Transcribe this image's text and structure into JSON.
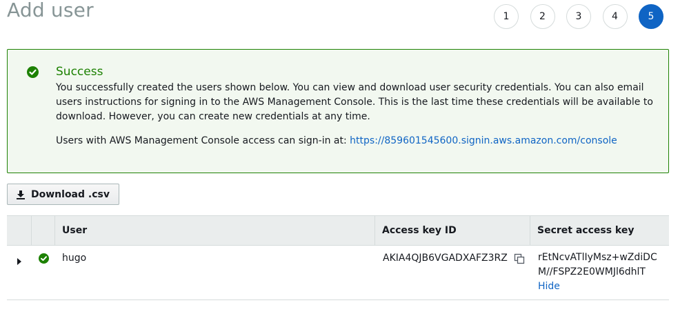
{
  "page": {
    "title": "Add user"
  },
  "steps": [
    "1",
    "2",
    "3",
    "4",
    "5"
  ],
  "active_step": "5",
  "alert": {
    "title": "Success",
    "body": "You successfully created the users shown below. You can view and download user security credentials. You can also email users instructions for signing in to the AWS Management Console. This is the last time these credentials will be available to download. However, you can create new credentials at any time.",
    "signin_prefix": "Users with AWS Management Console access can sign-in at: ",
    "signin_url": "https://859601545600.signin.aws.amazon.com/console",
    "status_color": "#1d8102"
  },
  "toolbar": {
    "download_label": "Download .csv"
  },
  "table": {
    "columns": [
      "User",
      "Access key ID",
      "Secret access key"
    ],
    "rows": [
      {
        "user": "hugo",
        "access_key_id": "AKIA4QJB6VGADXAFZ3RZ",
        "secret_access_key": "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",
        "hide_label": "Hide"
      }
    ]
  },
  "colors": {
    "accent": "#0f64c4",
    "success": "#1d8102"
  }
}
